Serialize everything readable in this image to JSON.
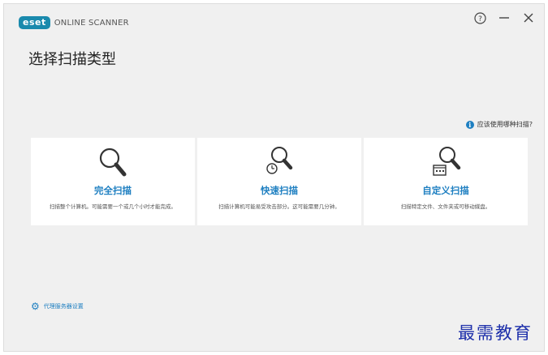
{
  "app": {
    "brand": "eset",
    "product": "ONLINE SCANNER"
  },
  "window_controls": {
    "help_icon": "help-circle-icon",
    "minimize_icon": "minimize-icon",
    "close_icon": "close-icon"
  },
  "page": {
    "title": "选择扫描类型"
  },
  "help_link": {
    "label": "应该使用哪种扫描?"
  },
  "cards": [
    {
      "title": "完全扫描",
      "desc": "扫描整个计算机。可能需要一个或几个小时才能完成。",
      "icon": "magnifier-icon"
    },
    {
      "title": "快速扫描",
      "desc": "扫描计算机可能易受攻击部分。这可能需要几分钟。",
      "icon": "quick-scan-icon"
    },
    {
      "title": "自定义扫描",
      "desc": "扫描特定文件、文件夹或可移动媒盘。",
      "icon": "custom-scan-icon"
    }
  ],
  "proxy": {
    "label": "代理服务器设置"
  },
  "watermark": "最需教育",
  "colors": {
    "accent": "#1e7fc1",
    "brand": "#1a8aad",
    "background": "#f0f0f0"
  }
}
